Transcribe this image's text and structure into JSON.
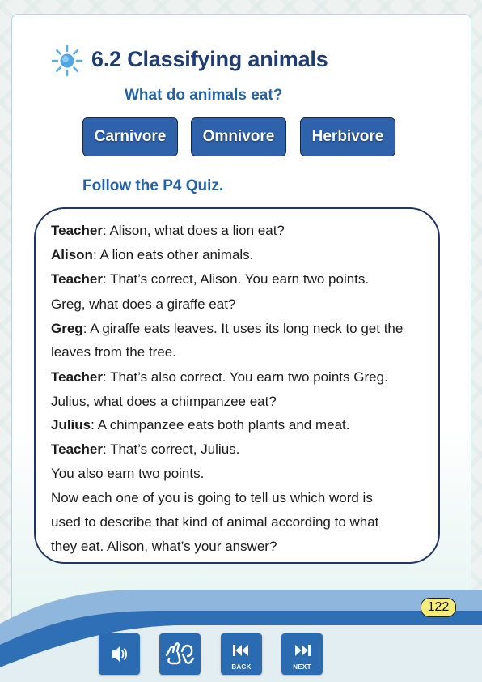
{
  "header": {
    "title": "6.2 Classifying animals",
    "subtitle": "What do animals eat?"
  },
  "categories": [
    "Carnivore",
    "Omnivore",
    "Herbivore"
  ],
  "instruction": "Follow the P4 Quiz.",
  "dialogue": [
    {
      "speaker": "Teacher",
      "text": ": Alison, what does a lion eat?"
    },
    {
      "speaker": "Alison",
      "text": ": A lion eats other animals."
    },
    {
      "speaker": "Teacher",
      "text": ": That’s correct, Alison. You earn two points."
    },
    {
      "speaker": "",
      "text": "Greg, what does a giraffe eat?"
    },
    {
      "speaker": "Greg",
      "text": ": A giraffe eats leaves. It uses its long neck to get the"
    },
    {
      "speaker": "",
      "text": "leaves from the tree."
    },
    {
      "speaker": "Teacher",
      "text": ": That’s also correct. You earn two points Greg."
    },
    {
      "speaker": "",
      "text": "Julius, what does a chimpanzee eat?"
    },
    {
      "speaker": "Julius",
      "text": ": A chimpanzee eats both plants and meat."
    },
    {
      "speaker": "Teacher",
      "text": ": That’s correct, Julius."
    },
    {
      "speaker": "",
      "text": "You also earn two points."
    },
    {
      "speaker": "",
      "text": "Now each one of you is going to tell us which word is"
    },
    {
      "speaker": "",
      "text": "used to describe that kind of animal according to what"
    },
    {
      "speaker": "",
      "text": "they eat. Alison, what’s your answer?"
    }
  ],
  "footer": {
    "page_number": "122",
    "back_label": "BACK",
    "next_label": "NEXT",
    "icons": [
      "speaker-icon",
      "sign-language-icon",
      "back-icon",
      "next-icon"
    ]
  },
  "colors": {
    "title": "#1f3c73",
    "accent": "#2462a8",
    "button": "#2e63ab",
    "page_badge": "#f6ec7b"
  }
}
